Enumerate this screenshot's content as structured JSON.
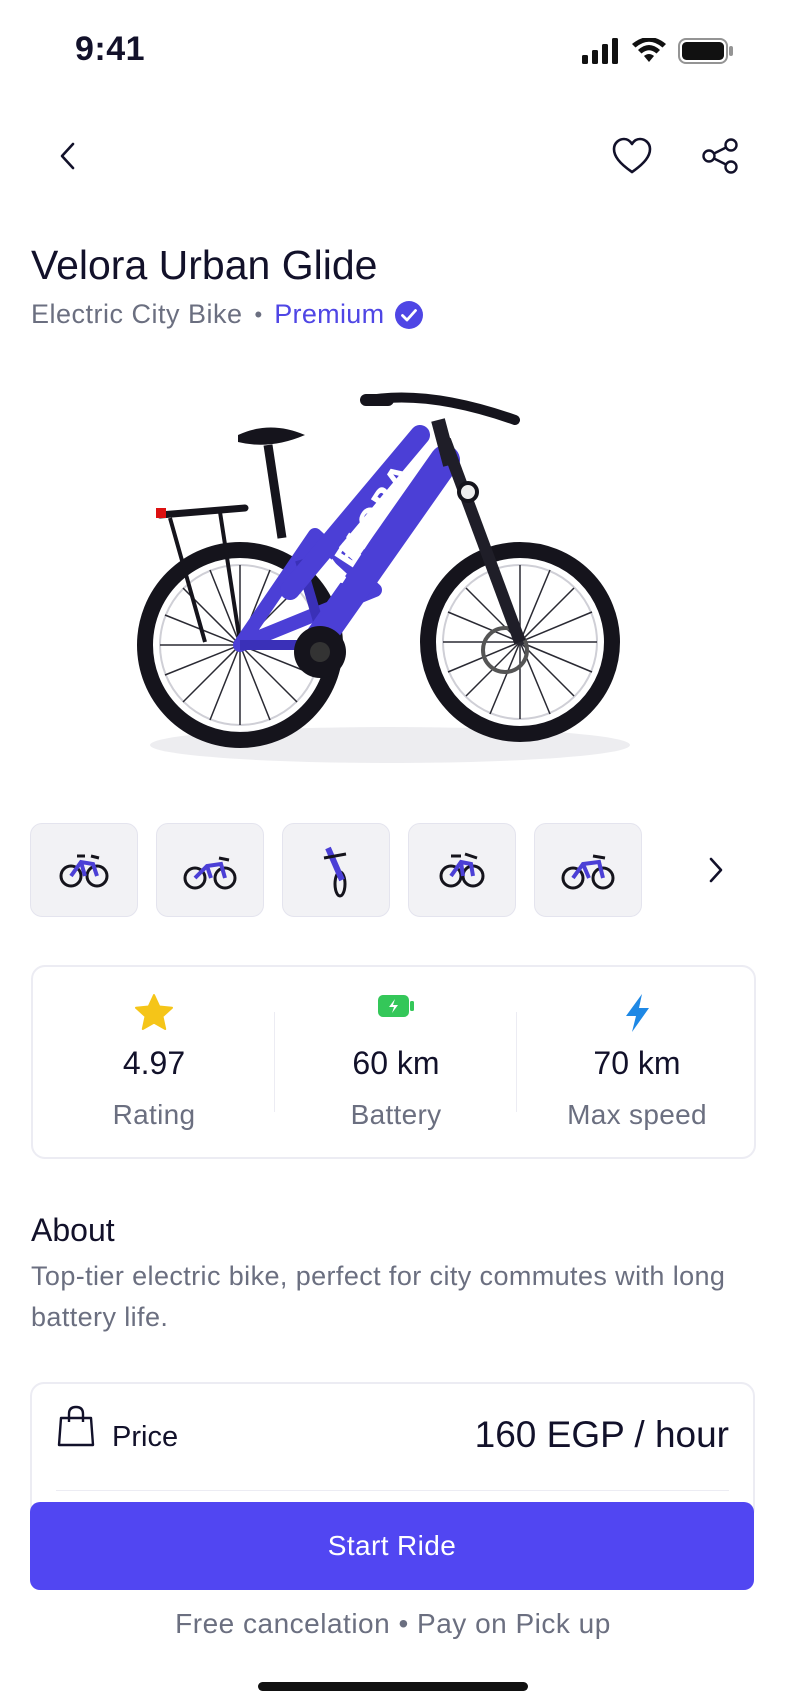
{
  "status_bar": {
    "time": "9:41"
  },
  "product": {
    "title": "Velora Urban Glide",
    "category": "Electric City Bike",
    "separator": "•",
    "badge": "Premium",
    "brand_text": "VELORA"
  },
  "gallery": {
    "thumbnail_count": 5
  },
  "stats": [
    {
      "icon": "star-icon",
      "value": "4.97",
      "label": "Rating",
      "color": "#f5c518"
    },
    {
      "icon": "battery-icon",
      "value": "60 km",
      "label": "Battery",
      "color": "#34c759"
    },
    {
      "icon": "lightning-icon",
      "value": "70 km",
      "label": "Max speed",
      "color": "#1e88e5"
    }
  ],
  "about": {
    "heading": "About",
    "text": "Top-tier electric bike, perfect for city commutes with long battery life."
  },
  "price": {
    "label": "Price",
    "value": "160 EGP / hour"
  },
  "actions": {
    "start_ride": "Start Ride"
  },
  "footer": {
    "note": "Free cancelation • Pay on Pick up"
  },
  "colors": {
    "accent": "#5146f2",
    "premium": "#4f46e5",
    "bike_frame": "#4b3fd6",
    "muted_text": "#6b6f80"
  }
}
